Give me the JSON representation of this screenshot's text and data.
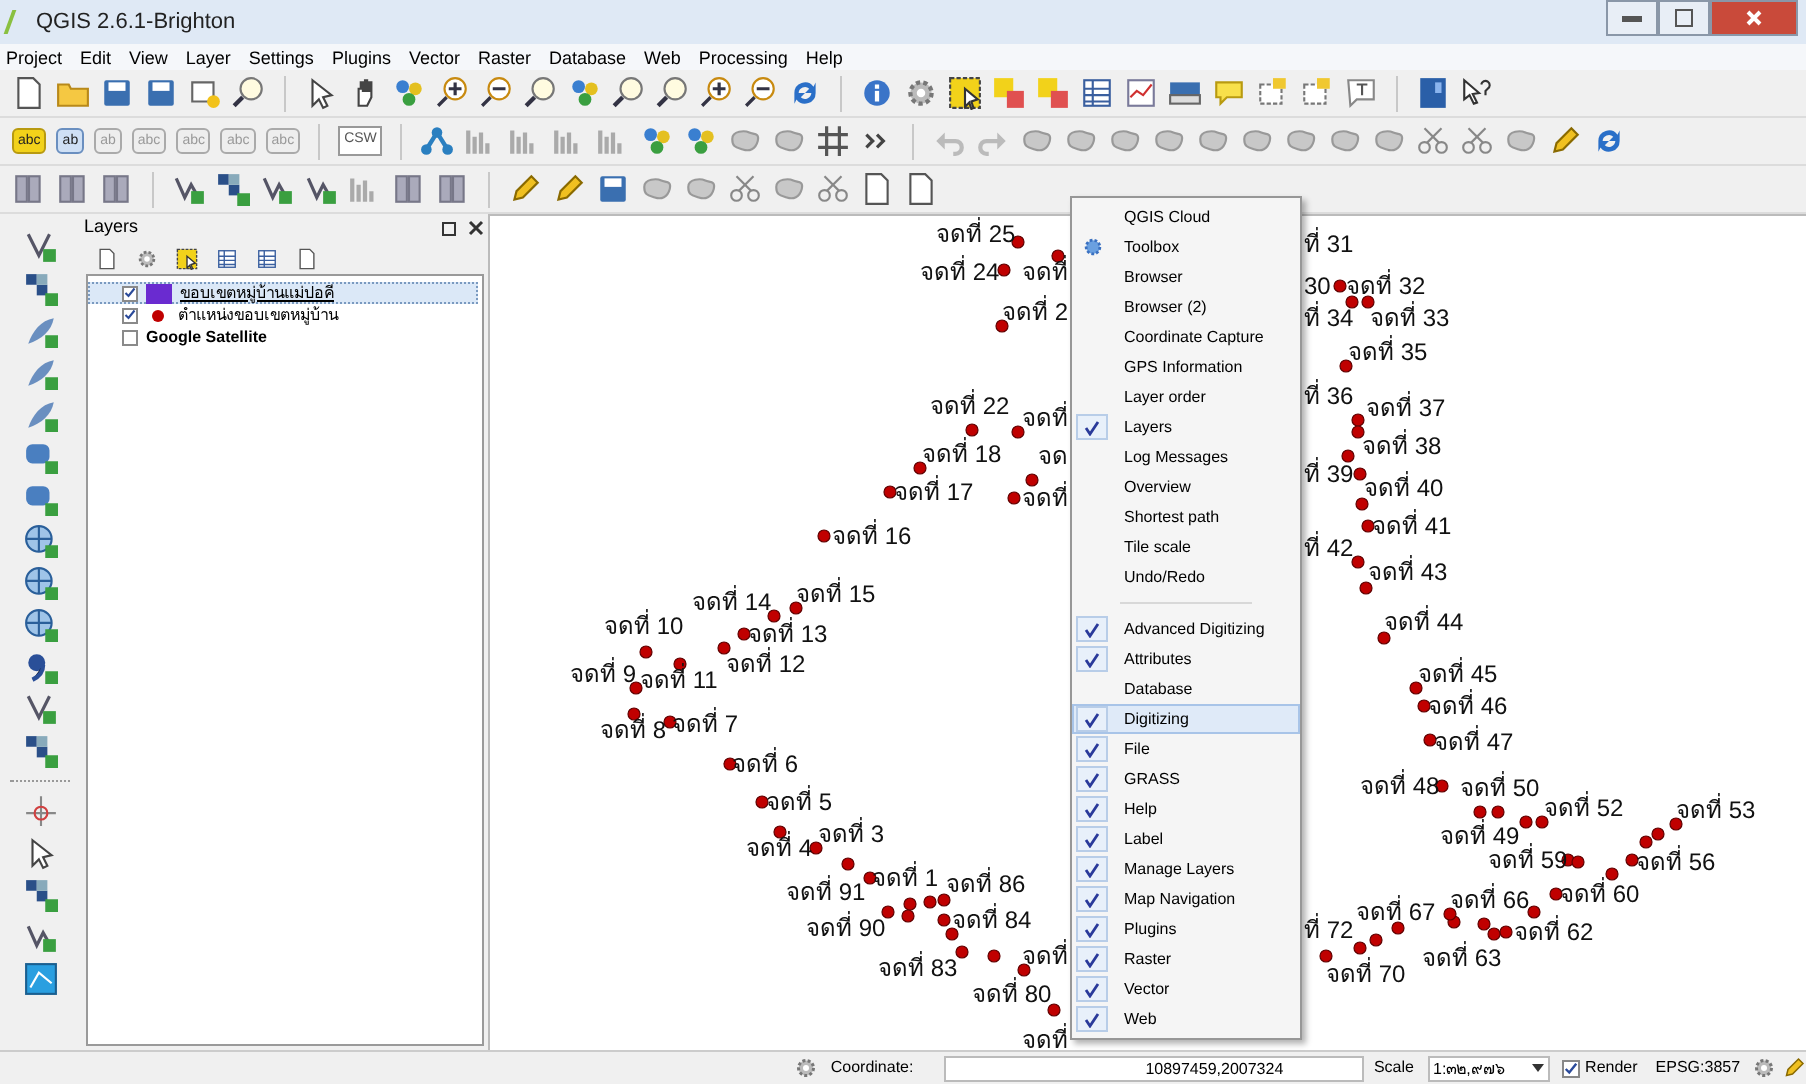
{
  "window": {
    "title": "QGIS 2.6.1-Brighton"
  },
  "menu_bar": [
    "Project",
    "Edit",
    "View",
    "Layer",
    "Settings",
    "Plugins",
    "Vector",
    "Raster",
    "Database",
    "Web",
    "Processing",
    "Help"
  ],
  "label_toolbar": [
    "abc",
    "ab",
    "ab",
    "abc",
    "abc",
    "abc",
    "abc"
  ],
  "csw_button": "CSW",
  "layers_panel": {
    "title": "Layers",
    "layers": [
      {
        "name": "ขอบเขตหมู่บ้านแม่ปอคี",
        "checked": true,
        "selected": true,
        "kind": "polygon",
        "color": "#6a2bd0"
      },
      {
        "name": "ตำแหน่งขอบเขตหมู่บ้าน",
        "checked": true,
        "selected": false,
        "kind": "point",
        "color": "#c00000"
      },
      {
        "name": "Google Satellite",
        "checked": false,
        "selected": false,
        "kind": "raster"
      }
    ]
  },
  "map": {
    "labels": [
      "จดที่ 25",
      "จดที่ 24",
      "จดที่",
      "จดที่ 2",
      "จดที่ 22",
      "จดที่",
      "จดที่ 18",
      "จด",
      "จดที่ 17",
      "จดที่",
      "จดที่ 16",
      "จดที่ 14",
      "จดที่ 15",
      "จดที่ 10",
      "จดที่ 13",
      "จดที่ 12",
      "จดที่ 9",
      "จดที่ 11",
      "จดที่ 8",
      "จดที่ 7",
      "จดที่ 6",
      "จดที่ 5",
      "จดที่ 4",
      "จดที่ 3",
      "จดที่ 1",
      "จดที่ 91",
      "จดที่ 86",
      "จดที่ 90",
      "จดที่ 84",
      "จดที่ 83",
      "จดที่",
      "จดที่ 80",
      "จดที่",
      "ที่ 31",
      "30",
      "จดที่ 32",
      "ที่ 34",
      "จดที่ 33",
      "จดที่ 35",
      "ที่ 36",
      "จดที่ 37",
      "จดที่ 38",
      "ที่ 39",
      "จดที่ 40",
      "จดที่ 41",
      "ที่ 42",
      "จดที่ 43",
      "จดที่ 44",
      "จดที่ 45",
      "จดที่ 46",
      "จดที่ 47",
      "จดที่ 48",
      "จดที่ 50",
      "จดที่ 49",
      "จดที่ 52",
      "จดที่ 53",
      "จดที่ 59",
      "จดที่ 56",
      "จดที่ 66",
      "จดที่ 60",
      "จดที่ 67",
      "จดที่ 62",
      "จดที่ 63",
      "ที่ 72",
      "จดที่ 70"
    ]
  },
  "panels_menu": {
    "sections": [
      [
        {
          "label": "QGIS Cloud",
          "kind": "plain",
          "checked": false,
          "selected": false
        },
        {
          "label": "Toolbox",
          "kind": "with-icon",
          "checked": false,
          "selected": false
        },
        {
          "label": "Browser",
          "kind": "plain",
          "checked": false,
          "selected": false
        },
        {
          "label": "Browser (2)",
          "kind": "plain",
          "checked": false,
          "selected": false
        },
        {
          "label": "Coordinate Capture",
          "kind": "plain",
          "checked": false,
          "selected": false
        },
        {
          "label": "GPS Information",
          "kind": "plain",
          "checked": false,
          "selected": false
        },
        {
          "label": "Layer order",
          "kind": "plain",
          "checked": false,
          "selected": false
        },
        {
          "label": "Layers",
          "kind": "plain",
          "checked": true,
          "selected": false
        },
        {
          "label": "Log Messages",
          "kind": "plain",
          "checked": false,
          "selected": false
        },
        {
          "label": "Overview",
          "kind": "plain",
          "checked": false,
          "selected": false
        },
        {
          "label": "Shortest path",
          "kind": "plain",
          "checked": false,
          "selected": false
        },
        {
          "label": "Tile scale",
          "kind": "plain",
          "checked": false,
          "selected": false
        },
        {
          "label": "Undo/Redo",
          "kind": "plain",
          "checked": false,
          "selected": false
        }
      ],
      [
        {
          "label": "Advanced Digitizing",
          "kind": "plain",
          "checked": true,
          "selected": false
        },
        {
          "label": "Attributes",
          "kind": "plain",
          "checked": true,
          "selected": false
        },
        {
          "label": "Database",
          "kind": "plain",
          "checked": false,
          "selected": false
        },
        {
          "label": "Digitizing",
          "kind": "plain",
          "checked": true,
          "selected": true
        },
        {
          "label": "File",
          "kind": "plain",
          "checked": true,
          "selected": false
        },
        {
          "label": "GRASS",
          "kind": "plain",
          "checked": true,
          "selected": false
        },
        {
          "label": "Help",
          "kind": "plain",
          "checked": true,
          "selected": false
        },
        {
          "label": "Label",
          "kind": "plain",
          "checked": true,
          "selected": false
        },
        {
          "label": "Manage Layers",
          "kind": "plain",
          "checked": true,
          "selected": false
        },
        {
          "label": "Map Navigation",
          "kind": "plain",
          "checked": true,
          "selected": false
        },
        {
          "label": "Plugins",
          "kind": "plain",
          "checked": true,
          "selected": false
        },
        {
          "label": "Raster",
          "kind": "plain",
          "checked": true,
          "selected": false
        },
        {
          "label": "Vector",
          "kind": "plain",
          "checked": true,
          "selected": false
        },
        {
          "label": "Web",
          "kind": "plain",
          "checked": true,
          "selected": false
        }
      ]
    ]
  },
  "status_bar": {
    "coordinate_label": "Coordinate:",
    "coordinate": "10897459,2007324",
    "scale_label": "Scale",
    "scale": "1:๓๒,๙๗๖",
    "render": {
      "label": "Render",
      "checked": true
    },
    "crs": "EPSG:3857"
  }
}
